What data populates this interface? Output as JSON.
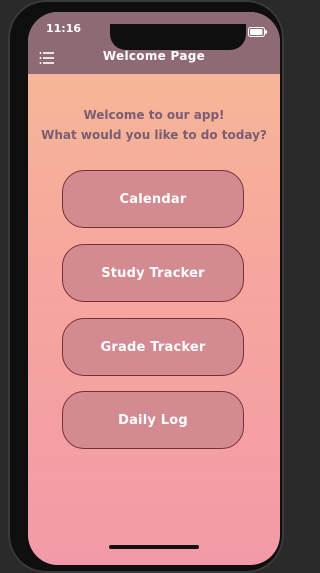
{
  "status_bar": {
    "time": "11:16"
  },
  "app_bar": {
    "title": "Welcome Page"
  },
  "main": {
    "welcome_line1": "Welcome to our app!",
    "welcome_line2": "What would you like to do today?",
    "buttons": [
      {
        "label": "Calendar"
      },
      {
        "label": "Study Tracker"
      },
      {
        "label": "Grade Tracker"
      },
      {
        "label": "Daily Log"
      }
    ]
  },
  "icons": {
    "menu": "menu-icon",
    "wifi": "wifi-icon",
    "battery": "battery-icon"
  },
  "colors": {
    "app_bar": "#8e6a75",
    "gradient_top": "#f7bb95",
    "gradient_bottom": "#f39aa8",
    "button_fill": "#d38a91",
    "button_border": "#7a2f34",
    "welcome_text": "#7a5d74"
  }
}
